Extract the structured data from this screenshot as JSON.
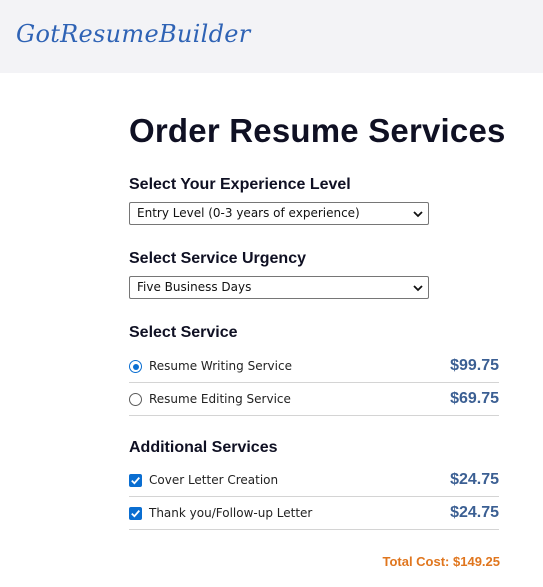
{
  "header": {
    "logo_text": "GotResumeBuilder"
  },
  "page": {
    "title": "Order Resume Services"
  },
  "experience": {
    "label": "Select Your Experience Level",
    "selected": "Entry Level (0-3 years of experience)"
  },
  "urgency": {
    "label": "Select Service Urgency",
    "selected": "Five Business Days"
  },
  "service": {
    "label": "Select Service",
    "options": [
      {
        "label": "Resume Writing Service",
        "price": "$99.75",
        "selected": true
      },
      {
        "label": "Resume Editing Service",
        "price": "$69.75",
        "selected": false
      }
    ]
  },
  "additional": {
    "label": "Additional Services",
    "options": [
      {
        "label": "Cover Letter Creation",
        "price": "$24.75",
        "checked": true
      },
      {
        "label": "Thank you/Follow-up Letter",
        "price": "$24.75",
        "checked": true
      }
    ]
  },
  "total": {
    "text": "Total Cost: $149.25"
  },
  "colors": {
    "brand": "#2f63b5",
    "price": "#3b5f93",
    "total": "#e0761e",
    "control_accent": "#0a6ed1",
    "header_bg": "#f3f3f6"
  }
}
